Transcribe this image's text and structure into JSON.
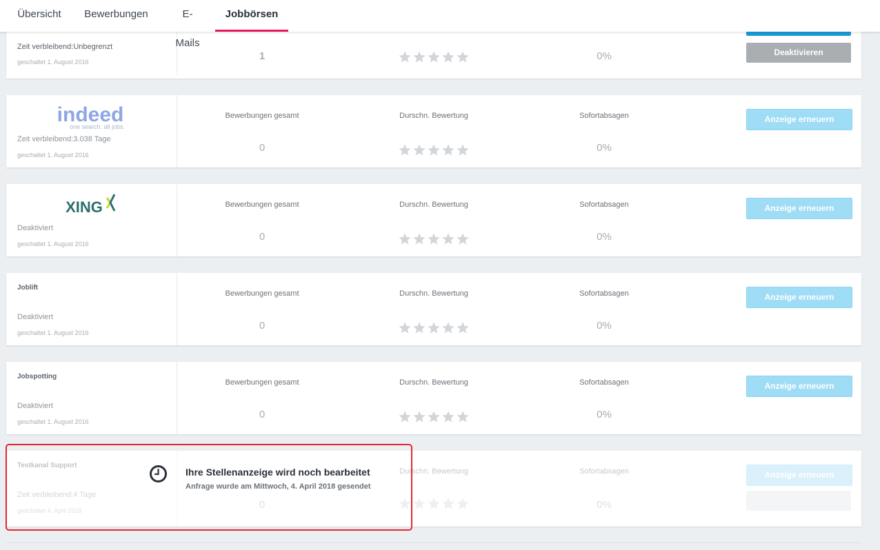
{
  "nav": {
    "tabs": [
      {
        "label": "Übersicht"
      },
      {
        "label": "Bewerbungen"
      },
      {
        "label": "E-Mails"
      },
      {
        "label": "Jobbörsen",
        "active": true
      }
    ]
  },
  "columns": {
    "applications": "Bewerbungen gesamt",
    "rating": "Durschn. Bewertung",
    "rejections": "Sofortabsagen"
  },
  "first_card": {
    "status": "Zeit verbleibend:Unbegrenzt",
    "date": "geschaltet 1. August 2016",
    "applications": "1",
    "rating_stars": 0,
    "rejections": "0%",
    "deactivate_label": "Deaktivieren"
  },
  "cards": [
    {
      "name": "Indeed",
      "logo": "indeed-logo",
      "logo_main": "indeed",
      "logo_sub": "one search. all jobs.",
      "status": "Zeit verbleibend:3.038 Tage",
      "date": "geschaltet 1. August 2016",
      "applications": "0",
      "rating_stars": 0,
      "rejections": "0%",
      "button": "Anzeige erneuern"
    },
    {
      "name": "XING",
      "logo": "xing-logo",
      "logo_main": "XING",
      "status": "Deaktiviert",
      "date": "geschaltet 1. August 2016",
      "applications": "0",
      "rating_stars": 0,
      "rejections": "0%",
      "button": "Anzeige erneuern"
    },
    {
      "name": "Joblift",
      "status": "Deaktiviert",
      "date": "geschaltet 1. August 2016",
      "applications": "0",
      "rating_stars": 0,
      "rejections": "0%",
      "button": "Anzeige erneuern"
    },
    {
      "name": "Jobspotting",
      "status": "Deaktiviert",
      "date": "geschaltet 1. August 2016",
      "applications": "0",
      "rating_stars": 0,
      "rejections": "0%",
      "button": "Anzeige erneuern"
    },
    {
      "name": "Testkanal Support",
      "status": "Zeit verbleibend:4 Tage",
      "date": "geschaltet 4. April 2018",
      "applications": "0",
      "rating_stars": 0,
      "rejections": "0%",
      "button": "Anzeige erneuern"
    }
  ],
  "notice": {
    "title": "Ihre Stellenanzeige wird noch bearbeitet",
    "subtitle": "Anfrage wurde am Mittwoch, 4. April 2018 gesendet",
    "icon": "clock-icon"
  },
  "colors": {
    "accent": "#e6185c",
    "button_primary": "#1a9bd7",
    "button_renew": "#9fdcf5",
    "button_deactivate": "#a9aeb3",
    "highlight": "#e3262f",
    "star": "#d2d6da"
  }
}
